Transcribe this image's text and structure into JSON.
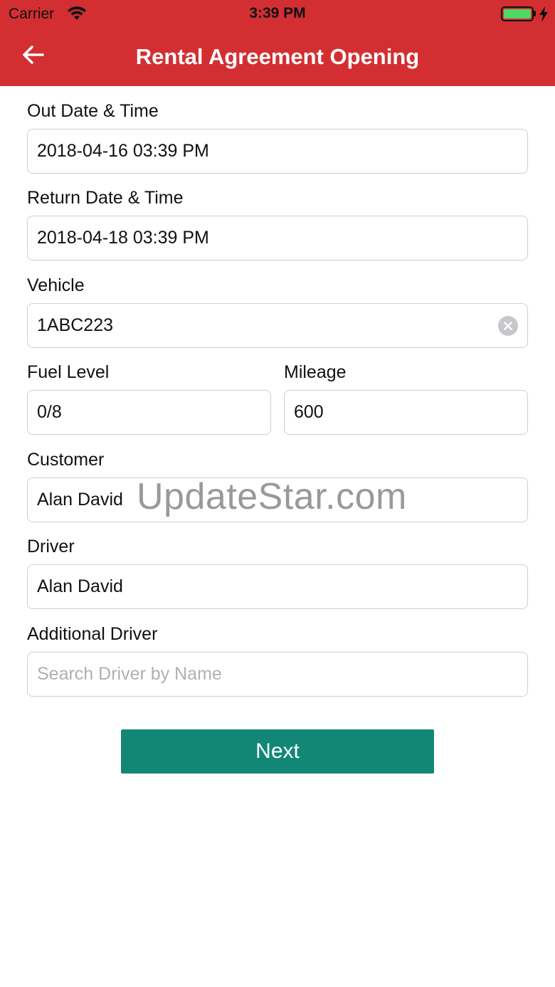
{
  "status_bar": {
    "carrier": "Carrier",
    "time": "3:39 PM"
  },
  "nav": {
    "title": "Rental Agreement Opening",
    "back_icon": "arrow-left-icon"
  },
  "form": {
    "out_date": {
      "label": "Out Date & Time",
      "value": "2018-04-16 03:39 PM"
    },
    "return_date": {
      "label": "Return Date & Time",
      "value": "2018-04-18 03:39 PM"
    },
    "vehicle": {
      "label": "Vehicle",
      "value": "1ABC223",
      "clear_icon": "clear-circle-icon"
    },
    "fuel_level": {
      "label": "Fuel Level",
      "value": "0/8"
    },
    "mileage": {
      "label": "Mileage",
      "value": "600"
    },
    "customer": {
      "label": "Customer",
      "value": "Alan David"
    },
    "driver": {
      "label": "Driver",
      "value": "Alan David"
    },
    "additional_driver": {
      "label": "Additional Driver",
      "placeholder": "Search Driver by Name"
    }
  },
  "actions": {
    "next_label": "Next"
  },
  "watermark": "UpdateStar.com",
  "colors": {
    "header": "#d32f32",
    "button": "#138776",
    "battery": "#4cd964"
  }
}
